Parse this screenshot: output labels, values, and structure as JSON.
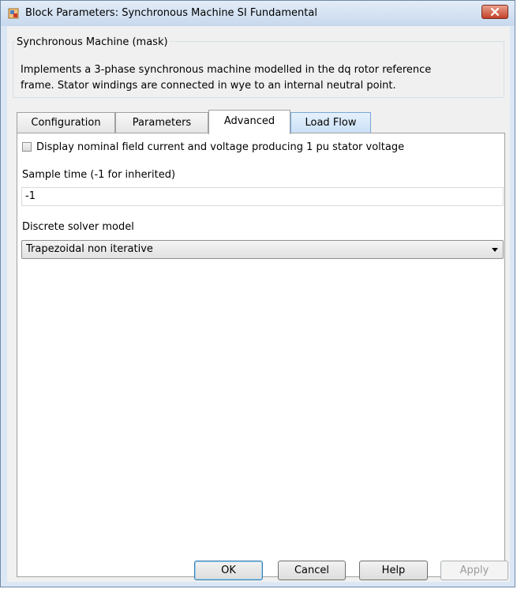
{
  "window": {
    "title": "Block Parameters: Synchronous Machine SI Fundamental"
  },
  "mask": {
    "legend": "Synchronous Machine (mask)",
    "description_line1": "Implements a 3-phase synchronous machine modelled in the dq rotor reference",
    "description_line2": "frame. Stator windings are connected in wye to an internal neutral point."
  },
  "tabs": [
    {
      "label": "Configuration"
    },
    {
      "label": "Parameters"
    },
    {
      "label": "Advanced"
    },
    {
      "label": "Load Flow"
    }
  ],
  "advanced": {
    "checkbox_label": "Display nominal field current and voltage producing 1 pu stator voltage",
    "checkbox_checked": false,
    "sample_time_label": "Sample time (-1 for inherited)",
    "sample_time_value": "-1",
    "solver_label": "Discrete solver model",
    "solver_value": "Trapezoidal non iterative"
  },
  "buttons": {
    "ok": "OK",
    "cancel": "Cancel",
    "help": "Help",
    "apply": "Apply"
  },
  "icons": {
    "app": "simulink-block-icon",
    "close": "close-icon",
    "dropdown": "chevron-down-icon"
  }
}
